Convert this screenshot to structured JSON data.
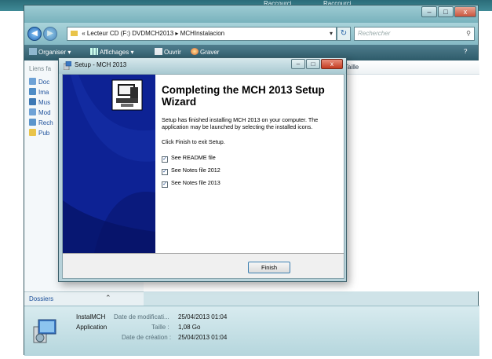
{
  "desktop": {
    "labels": [
      "Raccourci",
      "Raccourci"
    ]
  },
  "explorer": {
    "window_buttons": {
      "minimize": "–",
      "maximize": "□",
      "close": "x"
    },
    "address": {
      "prefix": "«",
      "path": [
        "Lecteur CD (F:) DVDMCH2013",
        "MCHInstalacion"
      ],
      "separator": "▸"
    },
    "search_placeholder": "Rechercher",
    "toolbar": {
      "organize": "Organiser",
      "views": "Affichages",
      "open": "Ouvrir",
      "burn": "Graver",
      "help": "?"
    },
    "favorites": {
      "title": "Liens fa",
      "items": [
        "Doc",
        "Ima",
        "Mus",
        "Mod",
        "Rech",
        "Pub"
      ]
    },
    "columns": [
      "Taille"
    ],
    "folders_label": "Dossiers",
    "details": {
      "file_name": "InstalMCH",
      "file_type": "Application",
      "modified_label": "Date de modificati...",
      "modified_value": "25/04/2013 01:04",
      "size_label": "Taille :",
      "size_value": "1,08 Go",
      "created_label": "Date de création :",
      "created_value": "25/04/2013 01:04"
    }
  },
  "setup_dialog": {
    "title": "Setup - MCH 2013",
    "heading": "Completing the MCH 2013 Setup Wizard",
    "description": "Setup has finished installing MCH 2013 on your computer. The application may be launched by selecting the installed icons.",
    "exit_text": "Click Finish to exit Setup.",
    "checkboxes": [
      {
        "label": "See README file",
        "checked": true
      },
      {
        "label": "See Notes file 2012",
        "checked": true
      },
      {
        "label": "See Notes file 2013",
        "checked": true
      }
    ],
    "finish_label": "Finish"
  },
  "colors": {
    "wizard_side": "#0a1a7d",
    "toolbar": "#3c6878",
    "finish_border": "#3c7fb1"
  }
}
